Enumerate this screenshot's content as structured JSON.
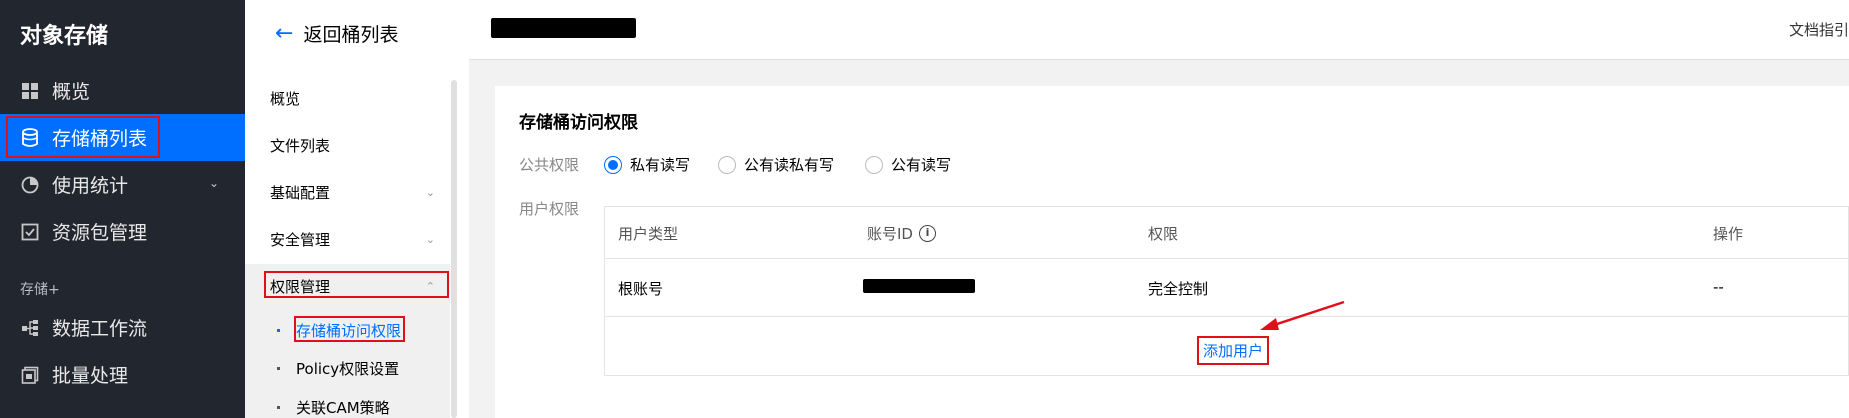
{
  "sidebar": {
    "title": "对象存储",
    "items": [
      {
        "label": "概览",
        "icon": "grid-icon"
      },
      {
        "label": "存储桶列表",
        "icon": "bucket-icon",
        "active": true
      },
      {
        "label": "使用统计",
        "icon": "pie-chart-icon",
        "expandable": true
      },
      {
        "label": "资源包管理",
        "icon": "package-icon"
      }
    ],
    "section_label": "存储+",
    "section_items": [
      {
        "label": "数据工作流",
        "icon": "workflow-icon"
      },
      {
        "label": "批量处理",
        "icon": "batch-icon"
      }
    ]
  },
  "subnav": {
    "back_label": "返回桶列表",
    "items": [
      {
        "label": "概览"
      },
      {
        "label": "文件列表"
      },
      {
        "label": "基础配置",
        "expandable": true
      },
      {
        "label": "安全管理",
        "expandable": true
      },
      {
        "label": "权限管理",
        "expanded": true
      }
    ],
    "children": [
      {
        "label": "存储桶访问权限",
        "active": true
      },
      {
        "label": "Policy权限设置"
      },
      {
        "label": "关联CAM策略"
      }
    ]
  },
  "header": {
    "doc_link": "文档指引"
  },
  "card": {
    "title": "存储桶访问权限",
    "public_label": "公共权限",
    "public_options": [
      {
        "label": "私有读写",
        "checked": true
      },
      {
        "label": "公有读私有写",
        "checked": false
      },
      {
        "label": "公有读写",
        "checked": false
      }
    ],
    "user_label": "用户权限",
    "table": {
      "columns": [
        "用户类型",
        "账号ID",
        "权限",
        "操作"
      ],
      "rows": [
        {
          "user_type": "根账号",
          "permission": "完全控制",
          "action": "--"
        }
      ],
      "add_user": "添加用户"
    }
  },
  "colors": {
    "accent": "#006eff",
    "sidebar_bg": "#22262f",
    "annotation_red": "#e0101a"
  }
}
